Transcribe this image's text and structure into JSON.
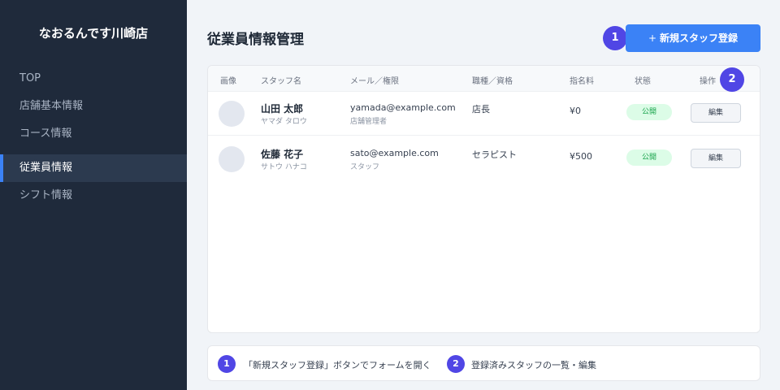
{
  "sidebar": {
    "brand": "なおるんです川崎店",
    "items": [
      {
        "label": "TOP"
      },
      {
        "label": "店舗基本情報"
      },
      {
        "label": "コース情報"
      },
      {
        "label": "従業員情報",
        "active": true
      },
      {
        "label": "シフト情報"
      }
    ]
  },
  "header": {
    "title": "従業員情報管理",
    "new_button": "新規スタッフ登録",
    "new_button_plus": "+"
  },
  "table": {
    "columns": [
      "画像",
      "スタッフ名",
      "メール／権限",
      "職種／資格",
      "指名料",
      "状態",
      "操作"
    ],
    "rows": [
      {
        "name": "山田 太郎",
        "kana": "ヤマダ タロウ",
        "email": "yamada@example.com",
        "role": "店舗管理者",
        "job": "店長",
        "fee": "¥0",
        "status": "公開",
        "edit": "編集"
      },
      {
        "name": "佐藤 花子",
        "kana": "サトウ ハナコ",
        "email": "sato@example.com",
        "role": "スタッフ",
        "job": "セラピスト",
        "fee": "¥500",
        "status": "公開",
        "edit": "編集"
      }
    ]
  },
  "badges": {
    "one": "1",
    "two": "2"
  },
  "legend": {
    "item1": "「新規スタッフ登録」ボタンでフォームを開く",
    "item2": "登録済みスタッフの一覧・編集"
  },
  "colors": {
    "accent": "#3b82f6",
    "badge": "#5046e5",
    "sidebar_bg": "#1f2a3b",
    "status_bg": "#dcfce7",
    "status_text": "#16a34a"
  }
}
